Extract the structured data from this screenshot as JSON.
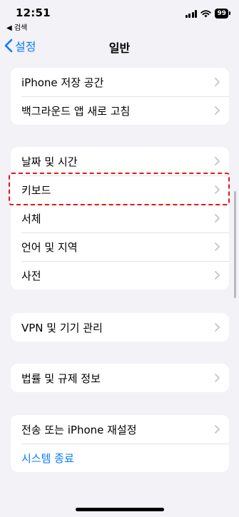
{
  "status_bar": {
    "time": "12:51",
    "back_app": "◀ 검색",
    "battery": "99"
  },
  "nav": {
    "back_label": "설정",
    "title": "일반"
  },
  "groups": [
    {
      "items": [
        {
          "label": "iPhone 저장 공간"
        },
        {
          "label": "백그라운드 앱 새로 고침"
        }
      ]
    },
    {
      "items": [
        {
          "label": "날짜 및 시간"
        },
        {
          "label": "키보드"
        },
        {
          "label": "서체"
        },
        {
          "label": "언어 및 지역"
        },
        {
          "label": "사전"
        }
      ]
    },
    {
      "items": [
        {
          "label": "VPN 및 기기 관리"
        }
      ]
    },
    {
      "items": [
        {
          "label": "법률 및 규제 정보"
        }
      ]
    },
    {
      "items": [
        {
          "label": "전송 또는 iPhone 재설정"
        },
        {
          "label": "시스템 종료"
        }
      ]
    }
  ],
  "colors": {
    "accent": "#0a7aff",
    "highlight": "#e0181a",
    "background": "#f2f2f7"
  }
}
